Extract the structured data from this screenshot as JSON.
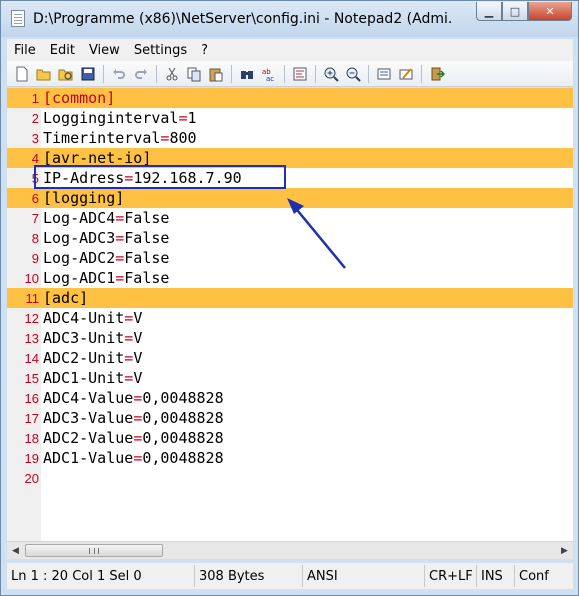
{
  "window": {
    "title": "D:\\Programme (x86)\\NetServer\\config.ini - Notepad2 (Admi...",
    "buttons": {
      "minimize": "▁",
      "maximize": "□",
      "close": "✕"
    }
  },
  "menu": {
    "items": [
      {
        "label": "File"
      },
      {
        "label": "Edit"
      },
      {
        "label": "View"
      },
      {
        "label": "Settings"
      },
      {
        "label": "?"
      }
    ]
  },
  "toolbar": {
    "icons": [
      "new-file-icon",
      "open-icon",
      "browse-icon",
      "save-icon",
      "undo-icon",
      "redo-icon",
      "cut-icon",
      "copy-icon",
      "paste-icon",
      "find-icon",
      "replace-icon",
      "word-wrap-icon",
      "zoom-in-icon",
      "zoom-out-icon",
      "scheme-icon",
      "customize-icon",
      "exit-icon"
    ]
  },
  "editor": {
    "lines": [
      {
        "num": "1",
        "text": "[common]",
        "type": "section"
      },
      {
        "num": "2",
        "key": "Logginginterval",
        "eq": "=",
        "value": "1"
      },
      {
        "num": "3",
        "key": "Timerinterval",
        "eq": "=",
        "value": "800"
      },
      {
        "num": "4",
        "text": "[avr-net-io]",
        "type": "section"
      },
      {
        "num": "5",
        "key": "IP-Adress",
        "eq": "=",
        "value": "192.168.7.90"
      },
      {
        "num": "6",
        "text": "[logging]",
        "type": "section"
      },
      {
        "num": "7",
        "key": "Log-ADC4",
        "eq": "=",
        "value": "False"
      },
      {
        "num": "8",
        "key": "Log-ADC3",
        "eq": "=",
        "value": "False"
      },
      {
        "num": "9",
        "key": "Log-ADC2",
        "eq": "=",
        "value": "False"
      },
      {
        "num": "10",
        "key": "Log-ADC1",
        "eq": "=",
        "value": "False"
      },
      {
        "num": "11",
        "text": "[adc]",
        "type": "section"
      },
      {
        "num": "12",
        "key": "ADC4-Unit",
        "eq": "=",
        "value": "V"
      },
      {
        "num": "13",
        "key": "ADC3-Unit",
        "eq": "=",
        "value": "V"
      },
      {
        "num": "14",
        "key": "ADC2-Unit",
        "eq": "=",
        "value": "V"
      },
      {
        "num": "15",
        "key": "ADC1-Unit",
        "eq": "=",
        "value": "V"
      },
      {
        "num": "16",
        "key": "ADC4-Value",
        "eq": "=",
        "value": "0,0048828"
      },
      {
        "num": "17",
        "key": "ADC3-Value",
        "eq": "=",
        "value": "0,0048828"
      },
      {
        "num": "18",
        "key": "ADC2-Value",
        "eq": "=",
        "value": "0,0048828"
      },
      {
        "num": "19",
        "key": "ADC1-Value",
        "eq": "=",
        "value": "0,0048828"
      },
      {
        "num": "20",
        "key": "",
        "eq": "",
        "value": ""
      }
    ]
  },
  "status": {
    "position": "Ln 1 : 20  Col 1  Sel 0",
    "size": "308 Bytes",
    "encoding": "ANSI",
    "line_ending": "CR+LF",
    "mode": "INS",
    "extra": "Conf"
  },
  "colors": {
    "section_highlight": "#ffc144",
    "line_number": "#c8001c",
    "annotation": "#1f2fb0"
  }
}
